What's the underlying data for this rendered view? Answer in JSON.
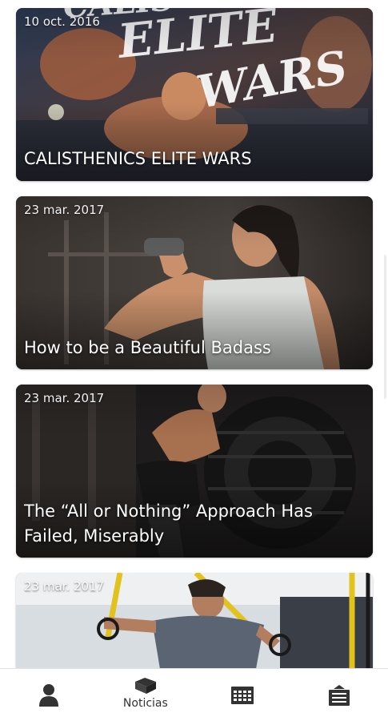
{
  "news": [
    {
      "date": "10 oct. 2016",
      "title": "CALISTHENICS ELITE WARS",
      "image_text": "CALISTHENICS ELITE WARS"
    },
    {
      "date": "23 mar. 2017",
      "title": "How to be a Beautiful Badass"
    },
    {
      "date": "23 mar. 2017",
      "title": "The “All or Nothing” Approach Has Failed, Miserably"
    },
    {
      "date": "23 mar. 2017",
      "title": ""
    }
  ],
  "tabbar": {
    "tabs": [
      {
        "icon": "user-icon",
        "label": ""
      },
      {
        "icon": "book-icon",
        "label": "Noticias"
      },
      {
        "icon": "calendar-icon",
        "label": ""
      },
      {
        "icon": "store-icon",
        "label": ""
      }
    ]
  }
}
